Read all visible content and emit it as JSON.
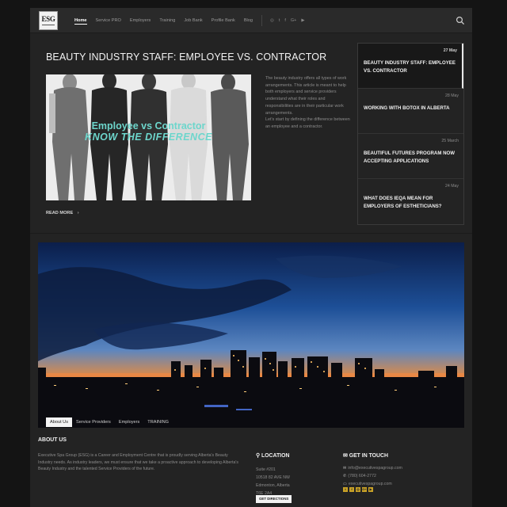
{
  "logo": {
    "text": "ESG"
  },
  "nav": {
    "items": [
      "Home",
      "Service PRO",
      "Employers",
      "Training",
      "Job Bank",
      "Profile Bank",
      "Blog"
    ],
    "active_index": 0
  },
  "social_icons": [
    "instagram-icon",
    "twitter-icon",
    "facebook-icon",
    "google-plus-icon",
    "youtube-icon"
  ],
  "social_glyphs": [
    "◎",
    "t",
    "f",
    "G+",
    "▶"
  ],
  "featured": {
    "title": "BEAUTY INDUSTRY STAFF: EMPLOYEE VS. CONTRACTOR",
    "image_caption_line1": "Employee vs Contractor",
    "image_caption_line2": "KNOW THE DIFFERENCE",
    "excerpt_p1": "The beauty industry offers all types of work arrangements. This article is meant to help both employers and service providers understand what their roles and responsibilities are in their particular work arrangements.",
    "excerpt_p2": "Let's start by defining the difference between an employee and a contractor.",
    "read_more": "READ MORE"
  },
  "posts": [
    {
      "date": "27 May",
      "title": "BEAUTY INDUSTRY STAFF: EMPLOYEE VS. CONTRACTOR",
      "active": true
    },
    {
      "date": "28 May",
      "title": "WORKING WITH BOTOX IN ALBERTA",
      "active": false
    },
    {
      "date": "25 March",
      "title": "BEAUTIFUL FUTURES PROGRAM NOW ACCEPTING APPLICATIONS",
      "active": false
    },
    {
      "date": "24 May",
      "title": "WHAT DOES IEQA MEAN FOR EMPLOYERS OF ESTHETICIANS?",
      "active": false
    }
  ],
  "banner_tabs": {
    "items": [
      "About Us",
      "Service Providers",
      "Employers",
      "TRAINING"
    ],
    "active_index": 0
  },
  "about": {
    "heading": "ABOUT US",
    "text": "Executive Spa Group (ESG) is a Career and Employment Centre that is proudly serving Alberta's Beauty Industry needs. As industry leaders, we must ensure that we take a proactive approach to developing Alberta's Beauty Industry and the talented Service Providers of the future."
  },
  "location": {
    "heading": "LOCATION",
    "lines": [
      "Suite #201",
      "10518 82 AVE NW",
      "Edmonton, Alberta",
      "T6E 2A4"
    ],
    "directions_label": "GET DIRECTIONS"
  },
  "contact": {
    "heading": "GET IN TOUCH",
    "email": "info@executivespagroup.com",
    "phone": "(780) 604-2772",
    "website": "executivespagroup.com"
  },
  "footer_social": [
    "t",
    "f",
    "◎",
    "G+",
    "▶"
  ],
  "colors": {
    "accent_teal": "#6dd6cc",
    "social_gold": "#c9a227",
    "background": "#232323"
  }
}
